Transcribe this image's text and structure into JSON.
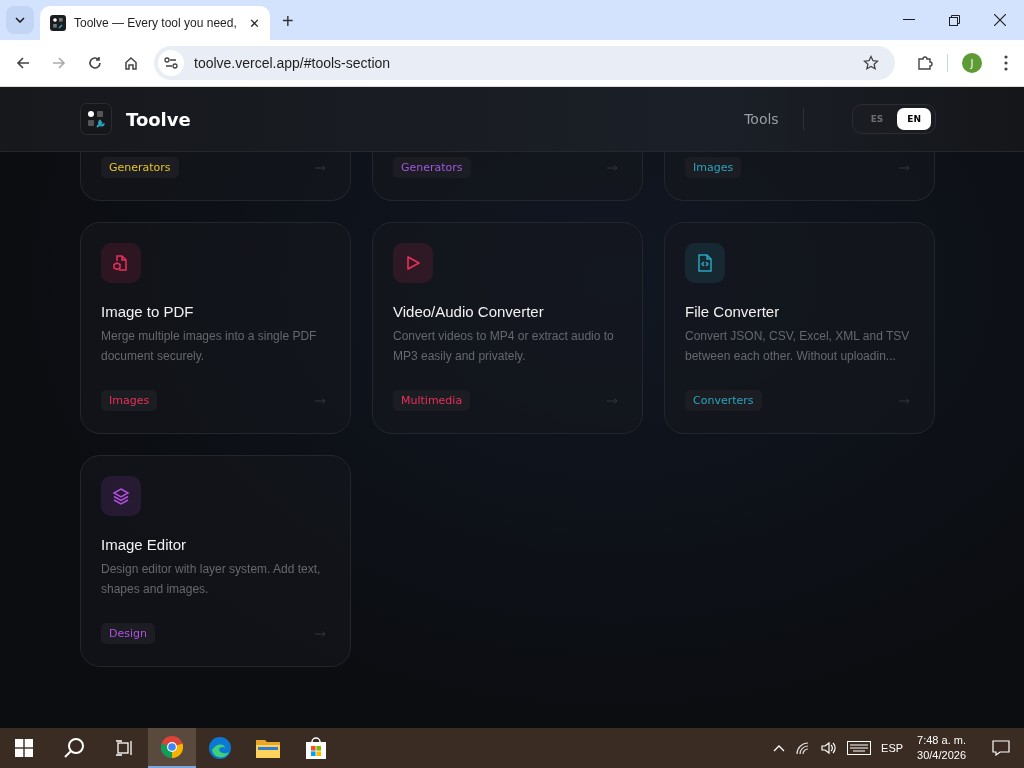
{
  "browser": {
    "tab": {
      "title": "Toolve — Every tool you need,",
      "close": "✕"
    },
    "new_tab": "+",
    "url": "toolve.vercel.app/#tools-section",
    "profile": "J"
  },
  "header": {
    "brand": "Toolve",
    "nav": "Tools",
    "languages": [
      {
        "label": "ES",
        "selected": false
      },
      {
        "label": "EN",
        "selected": true
      }
    ]
  },
  "cut_cards": [
    {
      "tag": "Generators",
      "color": "#e5c22b"
    },
    {
      "tag": "Generators",
      "color": "#a155e0"
    },
    {
      "tag": "Images",
      "color": "#2aa3bd"
    }
  ],
  "cards": [
    {
      "kind": "pdf",
      "title": "Image to PDF",
      "description": "Merge multiple images into a single PDF document securely.",
      "tag": "Images",
      "color": "#e8305a"
    },
    {
      "kind": "media",
      "title": "Video/Audio Converter",
      "description": "Convert videos to MP4 or extract audio to MP3 easily and privately.",
      "tag": "Multimedia",
      "color": "#e8305a"
    },
    {
      "kind": "converter",
      "title": "File Converter",
      "description": "Convert JSON, CSV, Excel, XML and TSV between each other. Without uploadin...",
      "tag": "Converters",
      "color": "#2aa3bd"
    },
    {
      "kind": "editor",
      "title": "Image Editor",
      "description": "Design editor with layer system. Add text, shapes and images.",
      "tag": "Design",
      "color": "#b34fe0"
    }
  ],
  "taskbar": {
    "apps": [
      {
        "kind": "chrome",
        "selected": true
      },
      {
        "kind": "edge",
        "selected": false
      },
      {
        "kind": "folder",
        "selected": false
      },
      {
        "kind": "store",
        "selected": false
      }
    ],
    "language": "ESP",
    "time": "7:48 a. m.",
    "date": "30/4/2026"
  }
}
